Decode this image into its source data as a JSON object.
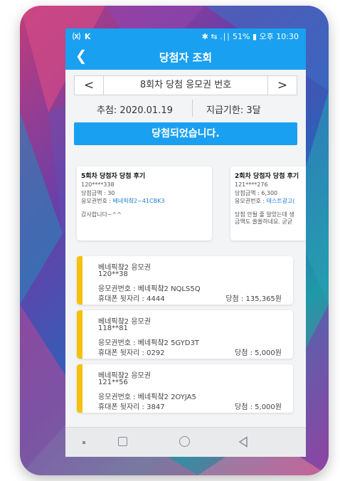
{
  "status_bar": {
    "left_icons": "⒳ K",
    "right_text": "✱ ⇆ .∣∣ 51% ▮ 오후 10:30"
  },
  "app_bar": {
    "title": "당첨자 조회",
    "back_icon": "chevron-left-icon"
  },
  "round_selector": {
    "label": "8회차 당첨 응모권 번호",
    "prev": "<",
    "next": ">"
  },
  "draw_info": {
    "draw_date": "추첨: 2020.01.19",
    "deadline": "지급기한: 3달"
  },
  "win_banner": "당첨되었습니다.",
  "reviews": [
    {
      "title": "5회차 당첨자 당첨 후기",
      "id": "120****338",
      "amount": "당첨금액 : 30",
      "ticket_label": "응모권번호 : ",
      "ticket_value": "베네픽챸2~41CBK3",
      "comment": "감사합니다~^^"
    },
    {
      "title": "2회차 당첨자 당첨 후기",
      "id": "121****276",
      "amount": "당첨금액 : 6,300",
      "ticket_label": "응모권번호 : ",
      "ticket_value": "테스트광고(",
      "comment": "당첨 안될 줄 알았는데 생",
      "comment2": "금액도 쏠쏠하네요. 굳굳"
    }
  ],
  "winners": [
    {
      "name": "베네픽챸2 응모권",
      "id": "120**38",
      "ticket": "응모권번호 : 베네픽챸2 NQLS5Q",
      "phone": "휴대폰 뒷자리 : 4444",
      "prize": "당첨 : 135,365원"
    },
    {
      "name": "베네픽챸2 응모권",
      "id": "118**81",
      "ticket": "응모권번호 : 베네픽챸2 5GYD3T",
      "phone": "휴대폰 뒷자리 : 0292",
      "prize": "당첨 : 5,000원"
    },
    {
      "name": "베네픽챸2 응모권",
      "id": "121**56",
      "ticket": "응모권번호 : 베네픽챸2 2OYJA5",
      "phone": "휴대폰 뒷자리 : 3847",
      "prize": "당첨 : 5,000원"
    }
  ],
  "nav_icons": [
    "recent-dot-icon",
    "square-icon",
    "home-circle-icon",
    "back-triangle-icon"
  ],
  "colors": {
    "accent": "#1aa0f0",
    "winner_bar": "#f4c20d",
    "link": "#1a7fd6"
  }
}
